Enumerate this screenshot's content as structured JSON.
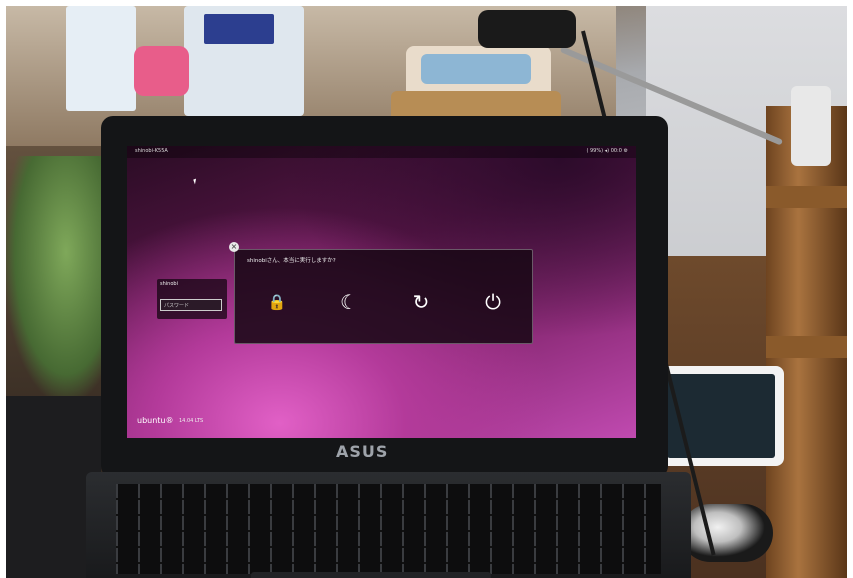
{
  "screen": {
    "topbar": {
      "left_text": "shinobi-K55A",
      "right_text": "( 99%) ◂) 00:0 ⚙"
    },
    "login": {
      "username": "shinobi",
      "password_placeholder": "パスワード"
    },
    "dialog": {
      "title": "shinobiさん、本当に実行しますか?",
      "close_glyph": "×",
      "buttons": [
        {
          "name": "lock",
          "glyph": "🔒"
        },
        {
          "name": "suspend",
          "glyph": "☾"
        },
        {
          "name": "restart",
          "glyph": "↻"
        },
        {
          "name": "shutdown",
          "glyph": "⏻"
        }
      ]
    },
    "branding": {
      "os": "ubuntu®",
      "version": "14.04 LTS"
    }
  },
  "laptop": {
    "logo": "ASUS"
  },
  "colors": {
    "wallpaper_dark": "#2a0c24",
    "wallpaper_light": "#c04ab0",
    "dialog_bg": "#19081a"
  }
}
